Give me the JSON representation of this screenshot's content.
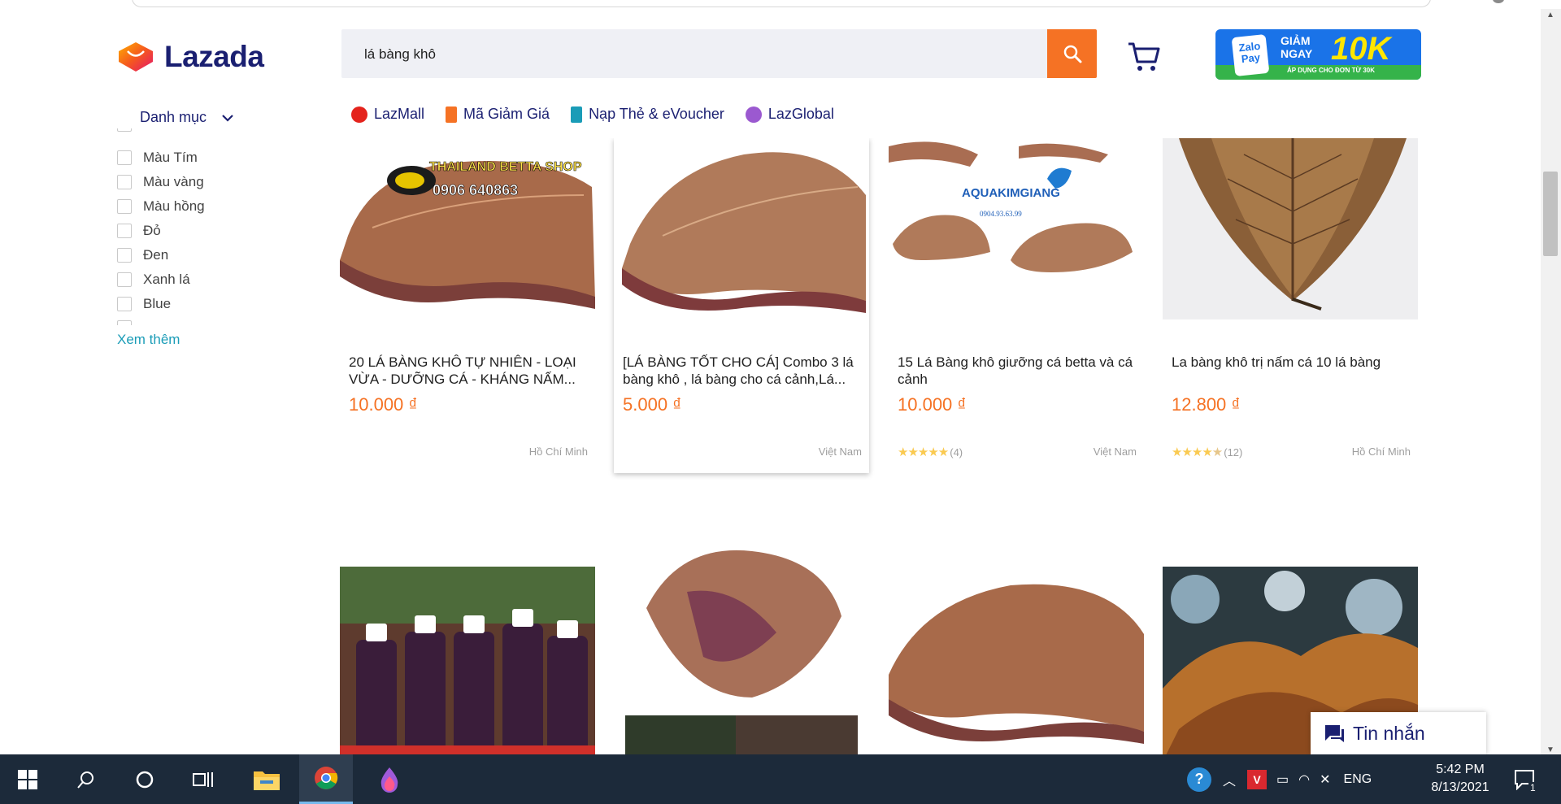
{
  "header": {
    "logo_text": "Lazada",
    "search_value": "lá bàng khô",
    "promo": {
      "logo_text": "Zalo Pay",
      "line1": "GIẢM",
      "line2": "NGAY",
      "amount": "10K",
      "sub": "ÁP DỤNG CHO ĐƠN TỪ 30K"
    }
  },
  "nav": {
    "category_label": "Danh mục",
    "items": [
      {
        "label": "LazMall",
        "icon": "lazmall-icon",
        "color": "#e4231c"
      },
      {
        "label": "Mã Giảm Giá",
        "icon": "voucher-icon",
        "color": "#f57224"
      },
      {
        "label": "Nạp Thẻ & eVoucher",
        "icon": "topup-icon",
        "color": "#1a9cb7"
      },
      {
        "label": "LazGlobal",
        "icon": "lazglobal-icon",
        "color": "#9b59d0"
      }
    ]
  },
  "filter": {
    "items": [
      "Màu Tím",
      "Màu vàng",
      "Màu hồng",
      "Đỏ",
      "Đen",
      "Xanh lá",
      "Blue"
    ],
    "more_label": "Xem thêm"
  },
  "products": [
    {
      "title": "20 LÁ BÀNG KHÔ TỰ NHIÊN - LOẠI VỪA - DƯỠNG CÁ - KHÁNG NẤM...",
      "price": "10.000 ₫",
      "location": "Hồ Chí Minh",
      "image_text": "THAILAND BETTA SHOP",
      "image_sub": "0906 640863"
    },
    {
      "title": "[LÁ BÀNG TỐT CHO CÁ] Combo 3 lá bàng khô , lá bàng cho cá cảnh,Lá...",
      "price": "5.000 ₫",
      "location": "Việt Nam"
    },
    {
      "title": "15 Lá Bàng khô giưỡng cá betta và cá cảnh",
      "price": "10.000 ₫",
      "location": "Việt Nam",
      "rating": "(4)",
      "stars": 5,
      "image_text": "AQUAKIMGIANG",
      "image_sub": "0904.93.63.99"
    },
    {
      "title": "La bàng khô trị nấm cá 10 lá bàng",
      "price": "12.800 ₫",
      "location": "Hồ Chí Minh",
      "rating": "(12)",
      "stars": 4.5
    }
  ],
  "chat": {
    "label": "Tin nhắn"
  },
  "taskbar": {
    "lang": "ENG",
    "time": "5:42 PM",
    "date": "8/13/2021",
    "notification_count": "1"
  },
  "colors": {
    "accent": "#f57224",
    "brand_navy": "#1a1f71",
    "link": "#1a9cb7",
    "taskbar": "#1c2a3a"
  }
}
